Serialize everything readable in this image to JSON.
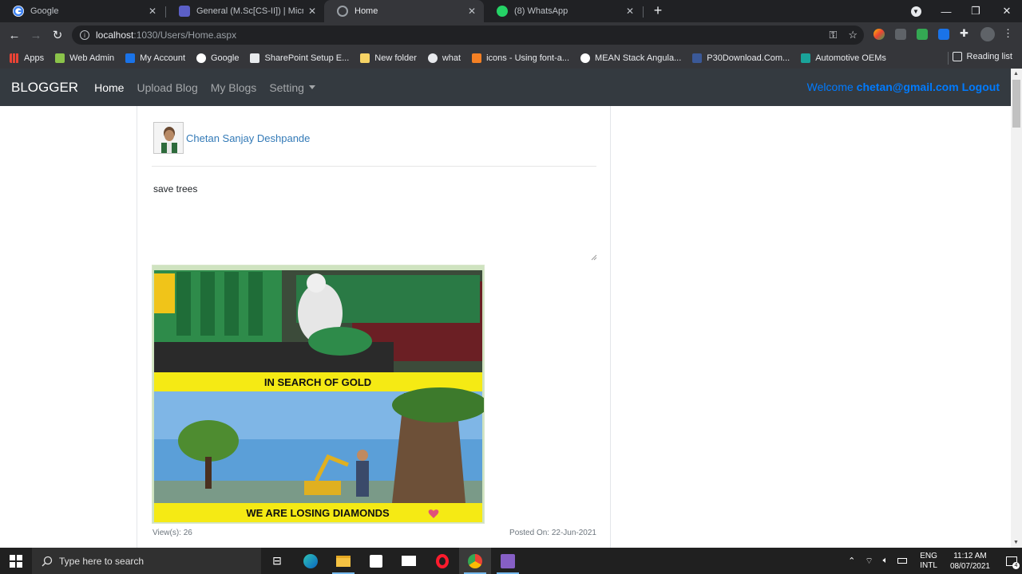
{
  "browser": {
    "tabs": [
      {
        "title": "Google",
        "icon": "google-icon",
        "active": false
      },
      {
        "title": "General (M.Sc[CS-II]) | Microsoft",
        "icon": "teams-icon",
        "active": false
      },
      {
        "title": "Home",
        "icon": "globe-icon",
        "active": true
      },
      {
        "title": "(8) WhatsApp",
        "icon": "whatsapp-icon",
        "active": false
      }
    ],
    "url_host": "localhost",
    "url_path": ":1030/Users/Home.aspx",
    "bookmarks": [
      "Apps",
      "Web Admin",
      "My Account",
      "Google",
      "SharePoint Setup E...",
      "New folder",
      "what",
      "icons - Using font-a...",
      "MEAN Stack Angula...",
      "P30Download.Com...",
      "Automotive OEMs"
    ],
    "reading_list": "Reading list"
  },
  "site": {
    "brand": "BLOGGER",
    "nav": {
      "home": "Home",
      "upload": "Upload Blog",
      "myblogs": "My Blogs",
      "setting": "Setting"
    },
    "welcome_prefix": "Welcome ",
    "user_email": "chetan@gmail.com",
    "logout": "Logout"
  },
  "post": {
    "author": "Chetan Sanjay Deshpande",
    "text": "save trees",
    "image_top_caption": "IN SEARCH OF GOLD",
    "image_bottom_caption": "WE ARE LOSING DIAMONDS",
    "views": "View(s): 26",
    "posted": "Posted On: 22-Jun-2021"
  },
  "taskbar": {
    "search_placeholder": "Type here to search",
    "lang_top": "ENG",
    "lang_bottom": "INTL",
    "time": "11:12 AM",
    "date": "08/07/2021",
    "notif_count": "4"
  },
  "colors": {
    "navbar_bg": "#343a40",
    "link_blue": "#007bff",
    "author_blue": "#337ab7"
  }
}
